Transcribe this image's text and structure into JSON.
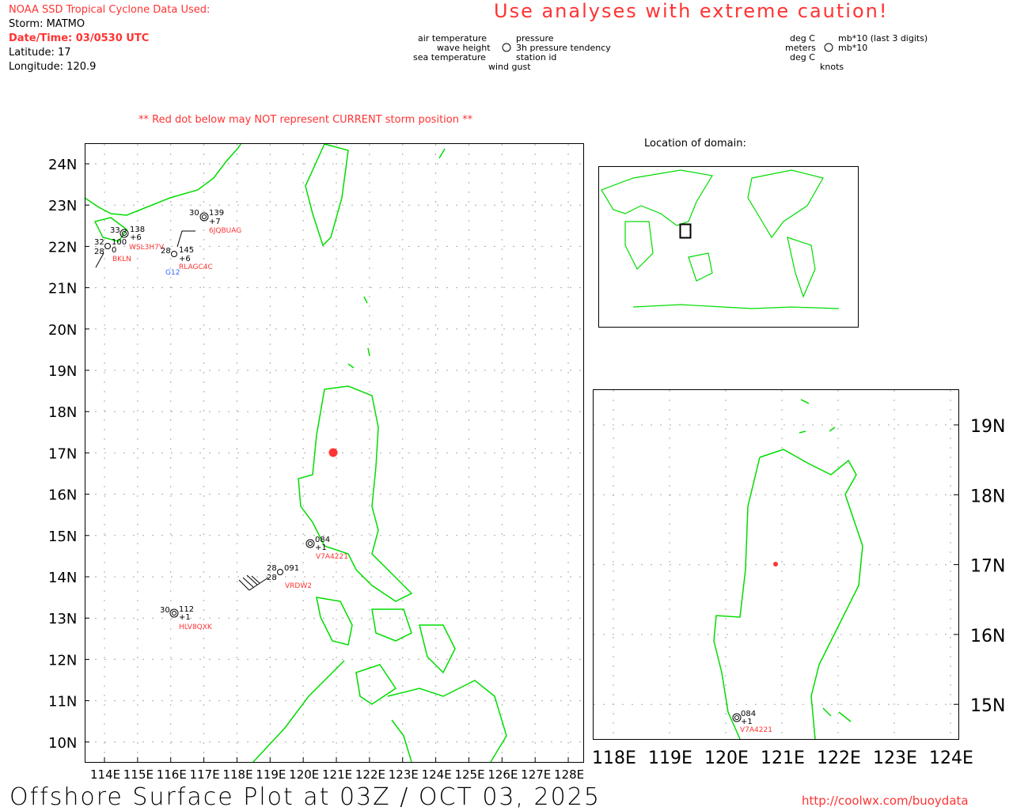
{
  "header": {
    "source": "NOAA SSD Tropical Cyclone Data Used:",
    "storm": "Storm: MATMO",
    "datetime": "Date/Time: 03/0530 UTC",
    "latitude": "Latitude: 17",
    "longitude": "Longitude: 120.9",
    "caution": "Use analyses with extreme caution!",
    "warning": "** Red dot below may NOT represent CURRENT storm position **"
  },
  "legend_left": {
    "air_temp": "air temperature",
    "wave": "wave height",
    "sea": "sea temperature",
    "wind": "wind gust",
    "pressure": "pressure",
    "tend": "3h pressure tendency",
    "station": "station id"
  },
  "legend_right": {
    "degc1": "deg C",
    "meters": "meters",
    "degc2": "deg C",
    "mb1": "mb*10 (last 3 digits)",
    "mb2": "mb*10",
    "knots": "knots"
  },
  "location_title": "Location of domain:",
  "main_map": {
    "lat_labels": [
      "24N",
      "23N",
      "22N",
      "21N",
      "20N",
      "19N",
      "18N",
      "17N",
      "16N",
      "15N",
      "14N",
      "13N",
      "12N",
      "11N",
      "10N"
    ],
    "lon_labels": [
      "114E",
      "115E",
      "116E",
      "117E",
      "118E",
      "119E",
      "120E",
      "121E",
      "122E",
      "123E",
      "124E",
      "125E",
      "126E",
      "127E",
      "128E"
    ]
  },
  "inset_map": {
    "lat_labels": [
      "19N",
      "18N",
      "17N",
      "16N",
      "15N"
    ],
    "lon_labels": [
      "118E",
      "119E",
      "120E",
      "121E",
      "122E",
      "123E",
      "124E"
    ]
  },
  "storm_position": {
    "lat": 17,
    "lon": 120.9,
    "color": "#ff3333"
  },
  "stations": [
    {
      "id": "6JQBUAG",
      "air": "30",
      "pres": "139",
      "tend": "+7",
      "id_color": "#ff3333"
    },
    {
      "id": "WSL3H7V",
      "air": "33",
      "pres": "138",
      "tend": "+6",
      "id_color": "#ff3333"
    },
    {
      "id": "BKLN",
      "air": "32",
      "sea": "28",
      "pres": "100",
      "tend": "0",
      "id_color": "#ff3333"
    },
    {
      "id": "RLAGC4C",
      "air": "28",
      "pres": "145",
      "tend": "+6",
      "id_color": "#ff3333"
    },
    {
      "id": "G12",
      "id_color": "#3366ff"
    },
    {
      "id": "V7A4221",
      "pres": "084",
      "tend": "+1",
      "id_color": "#ff3333"
    },
    {
      "id": "VRDW2",
      "air": "28",
      "sea": "28",
      "pres": "091",
      "id_color": "#ff3333"
    },
    {
      "id": "HLV8QXK",
      "air": "30",
      "pres": "112",
      "tend": "+1",
      "id_color": "#ff3333"
    }
  ],
  "inset_station": {
    "id": "V7A4221",
    "pres": "084",
    "tend": "+1"
  },
  "footer": {
    "title": "Offshore Surface Plot at 03Z / OCT 03, 2025",
    "url": "http://coolwx.com/buoydata"
  },
  "colors": {
    "coast": "#00dd00",
    "red": "#ff3333",
    "grid": "#aaaaaa"
  }
}
